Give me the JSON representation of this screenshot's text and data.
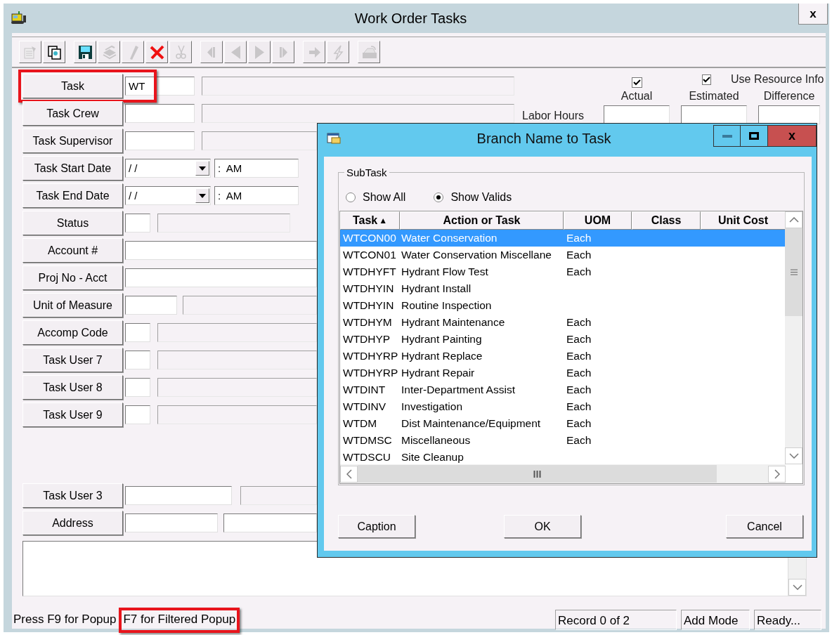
{
  "window": {
    "title": "Work Order Tasks",
    "close": "x"
  },
  "toolbar": {
    "groups": [
      [
        {
          "kind": "properties",
          "disabled": true
        },
        {
          "kind": "copy",
          "disabled": false
        }
      ],
      [
        {
          "kind": "save",
          "disabled": false
        },
        {
          "kind": "stack",
          "disabled": true
        },
        {
          "kind": "pencil",
          "disabled": true
        },
        {
          "kind": "delete",
          "disabled": false
        },
        {
          "kind": "cut",
          "disabled": true
        }
      ],
      [
        {
          "kind": "first",
          "disabled": true
        },
        {
          "kind": "previous",
          "disabled": true
        },
        {
          "kind": "next",
          "disabled": true
        },
        {
          "kind": "last",
          "disabled": true
        }
      ],
      [
        {
          "kind": "forward",
          "disabled": true
        },
        {
          "kind": "lightning",
          "disabled": true
        }
      ],
      [
        {
          "kind": "export",
          "disabled": true
        }
      ]
    ]
  },
  "form": {
    "rows": [
      {
        "label": "Task",
        "highlighted": true,
        "fields": [
          {
            "kind": "input",
            "value": "WT"
          },
          {
            "kind": "readonly"
          }
        ]
      },
      {
        "label": "Task Crew",
        "highlighted": false,
        "fields": [
          {
            "kind": "input"
          },
          {
            "kind": "readonly"
          }
        ]
      },
      {
        "label": "Task Supervisor",
        "highlighted": false,
        "fields": [
          {
            "kind": "input"
          },
          {
            "kind": "readonly"
          }
        ]
      },
      {
        "label": "Task Start Date",
        "highlighted": false,
        "fields": [
          {
            "kind": "date",
            "value": "/ /"
          },
          {
            "kind": "time",
            "value": ":  AM"
          }
        ]
      },
      {
        "label": "Task End Date",
        "highlighted": false,
        "fields": [
          {
            "kind": "date",
            "value": "/ /"
          },
          {
            "kind": "time",
            "value": ":  AM"
          }
        ]
      },
      {
        "label": "Status",
        "highlighted": false,
        "fields": [
          {
            "kind": "input"
          },
          {
            "kind": "readonly"
          }
        ]
      },
      {
        "label": "Account #",
        "highlighted": false,
        "fields": [
          {
            "kind": "input"
          }
        ]
      },
      {
        "label": "Proj No - Acct",
        "highlighted": false,
        "fields": [
          {
            "kind": "input"
          }
        ]
      },
      {
        "label": "Unit of Measure",
        "highlighted": false,
        "fields": [
          {
            "kind": "input"
          },
          {
            "kind": "readonly"
          }
        ]
      },
      {
        "label": "Accomp Code",
        "highlighted": false,
        "fields": [
          {
            "kind": "input"
          },
          {
            "kind": "readonly"
          }
        ]
      },
      {
        "label": "Task User 7",
        "highlighted": false,
        "fields": [
          {
            "kind": "input"
          },
          {
            "kind": "readonly"
          }
        ]
      },
      {
        "label": "Task User 8",
        "highlighted": false,
        "fields": [
          {
            "kind": "input"
          },
          {
            "kind": "readonly"
          }
        ]
      },
      {
        "label": "Task User 9",
        "highlighted": false,
        "fields": [
          {
            "kind": "input"
          },
          {
            "kind": "readonly"
          }
        ]
      }
    ],
    "lower_rows": [
      {
        "label": "Task User 3",
        "highlighted": false,
        "fields": [
          {
            "kind": "input"
          },
          {
            "kind": "readonly"
          }
        ]
      },
      {
        "label": "Address",
        "highlighted": false,
        "fields": [
          {
            "kind": "input"
          },
          {
            "kind": "input"
          }
        ]
      }
    ],
    "labor": {
      "checks": [
        {
          "checked": true
        },
        {
          "checked": true,
          "label": "Use Resource Info"
        }
      ],
      "columns": [
        "Actual",
        "Estimated",
        "Difference"
      ],
      "row_label": "Labor Hours"
    }
  },
  "dialog": {
    "title": "Branch Name to Task",
    "close": "x",
    "group_label": "SubTask",
    "radios": [
      {
        "label": "Show All",
        "selected": false
      },
      {
        "label": "Show Valids",
        "selected": true
      }
    ],
    "columns": [
      {
        "label": "Task",
        "sort_mark": "▲"
      },
      {
        "label": "Action or Task"
      },
      {
        "label": "UOM"
      },
      {
        "label": "Class"
      },
      {
        "label": "Unit Cost"
      }
    ],
    "rows": [
      {
        "task": "WTCON00",
        "action": "Water Conservation",
        "uom": "Each",
        "selected": true
      },
      {
        "task": "WTCON01",
        "action": "Water Conservation Miscellane",
        "uom": "Each",
        "selected": false
      },
      {
        "task": "WTDHYFT",
        "action": "Hydrant Flow Test",
        "uom": "Each",
        "selected": false
      },
      {
        "task": "WTDHYIN",
        "action": "Hydrant Install",
        "selected": false
      },
      {
        "task": "WTDHYIN",
        "action": "Routine Inspection",
        "selected": false
      },
      {
        "task": "WTDHYM",
        "action": "Hydrant Maintenance",
        "uom": "Each",
        "selected": false
      },
      {
        "task": "WTDHYP",
        "action": "Hydrant Painting",
        "uom": "Each",
        "selected": false
      },
      {
        "task": "WTDHYRP",
        "action": "Hydrant Replace",
        "uom": "Each",
        "selected": false
      },
      {
        "task": "WTDHYRP",
        "action": "Hydrant Repair",
        "uom": "Each",
        "selected": false
      },
      {
        "task": "WTDINT",
        "action": "Inter-Department Assist",
        "uom": "Each",
        "selected": false
      },
      {
        "task": "WTDINV",
        "action": "Investigation",
        "uom": "Each",
        "selected": false
      },
      {
        "task": "WTDM",
        "action": "Dist Maintenance/Equipment",
        "uom": "Each",
        "selected": false
      },
      {
        "task": "WTDMSC",
        "action": "Miscellaneous",
        "uom": "Each",
        "selected": false
      },
      {
        "task": "WTDSCU",
        "action": "Site Cleanup",
        "selected": false
      }
    ],
    "buttons": [
      "Caption",
      "OK",
      "Cancel"
    ]
  },
  "status_bar": {
    "hints": [
      {
        "text": "Press F9 for Popup",
        "highlighted": false
      },
      {
        "text": "F7 for Filtered Popup",
        "highlighted": true
      }
    ],
    "panels": [
      "Record 0 of 2",
      "Add Mode",
      "Ready..."
    ]
  }
}
